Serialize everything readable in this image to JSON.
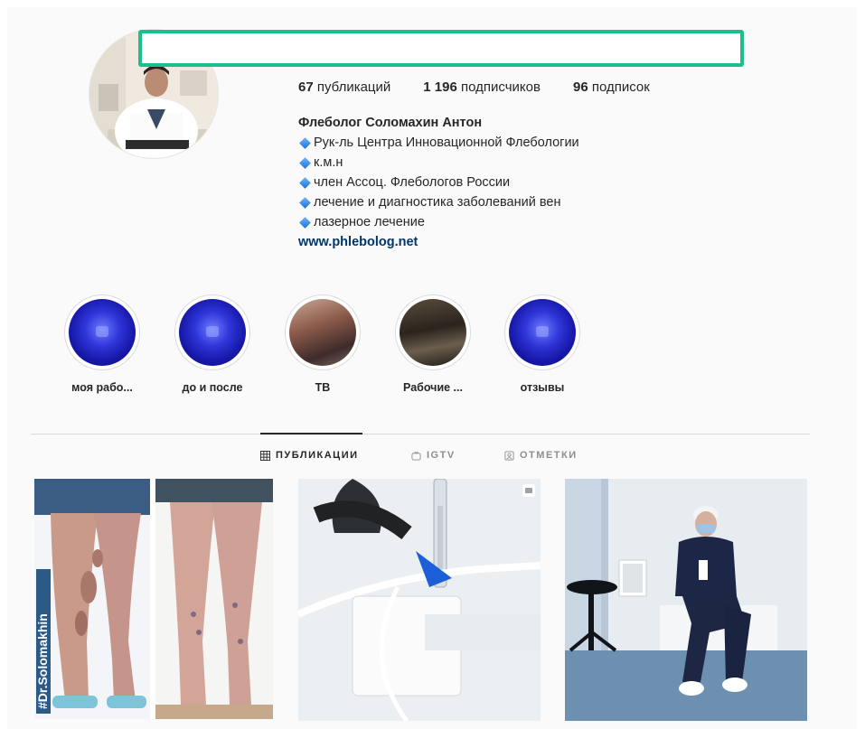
{
  "profile": {
    "stats": [
      {
        "count": "67",
        "label": "публикаций"
      },
      {
        "count": "1 196",
        "label": "подписчиков"
      },
      {
        "count": "96",
        "label": "подписок"
      }
    ],
    "name": "Флеболог Соломахин Антон",
    "bio_lines": [
      "Рук-ль Центра Инновационной Флебологии",
      "к.м.н",
      "член Ассоц. Флебологов России",
      "лечение и диагностика заболеваний вен",
      "лазерное лечение"
    ],
    "website": "www.phlebolog.net"
  },
  "highlights": [
    {
      "label": "моя рабо...",
      "style": "blue"
    },
    {
      "label": "до и после",
      "style": "blue"
    },
    {
      "label": "ТВ",
      "style": "photo"
    },
    {
      "label": "Рабочие ...",
      "style": "photo"
    },
    {
      "label": "отзывы",
      "style": "blue"
    }
  ],
  "tabs": [
    {
      "label": "ПУБЛИКАЦИИ",
      "icon": "grid-icon",
      "active": true
    },
    {
      "label": "IGTV",
      "icon": "igtv-icon",
      "active": false
    },
    {
      "label": "ОТМЕТКИ",
      "icon": "tagged-icon",
      "active": false
    }
  ],
  "posts": [
    {
      "watermark": "#Dr.Solomakhin"
    },
    {
      "type_icon": "clip-icon"
    },
    {}
  ],
  "colors": {
    "highlight_border": "#1dbe8e",
    "link": "#00376b",
    "text": "#262626",
    "muted": "#8e8e8e"
  }
}
